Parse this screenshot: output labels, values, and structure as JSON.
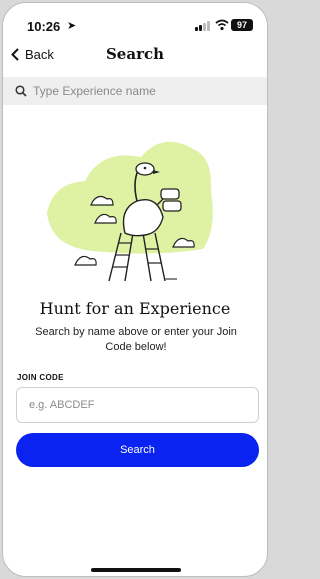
{
  "status_bar": {
    "time": "10:26",
    "battery": "97"
  },
  "nav": {
    "back_label": "Back",
    "title": "Search"
  },
  "search": {
    "placeholder": "Type Experience name"
  },
  "main": {
    "headline": "Hunt for an Experience",
    "subtitle": "Search by name above or enter your Join Code below!",
    "join_code_label": "JOIN CODE",
    "join_code_placeholder": "e.g. ABCDEF",
    "search_button_label": "Search"
  },
  "colors": {
    "accent": "#0a23f0",
    "illustration_green": "#dff2a4"
  },
  "icons": {
    "back": "chevron-left-icon",
    "search": "search-icon",
    "location": "location-arrow-icon"
  }
}
